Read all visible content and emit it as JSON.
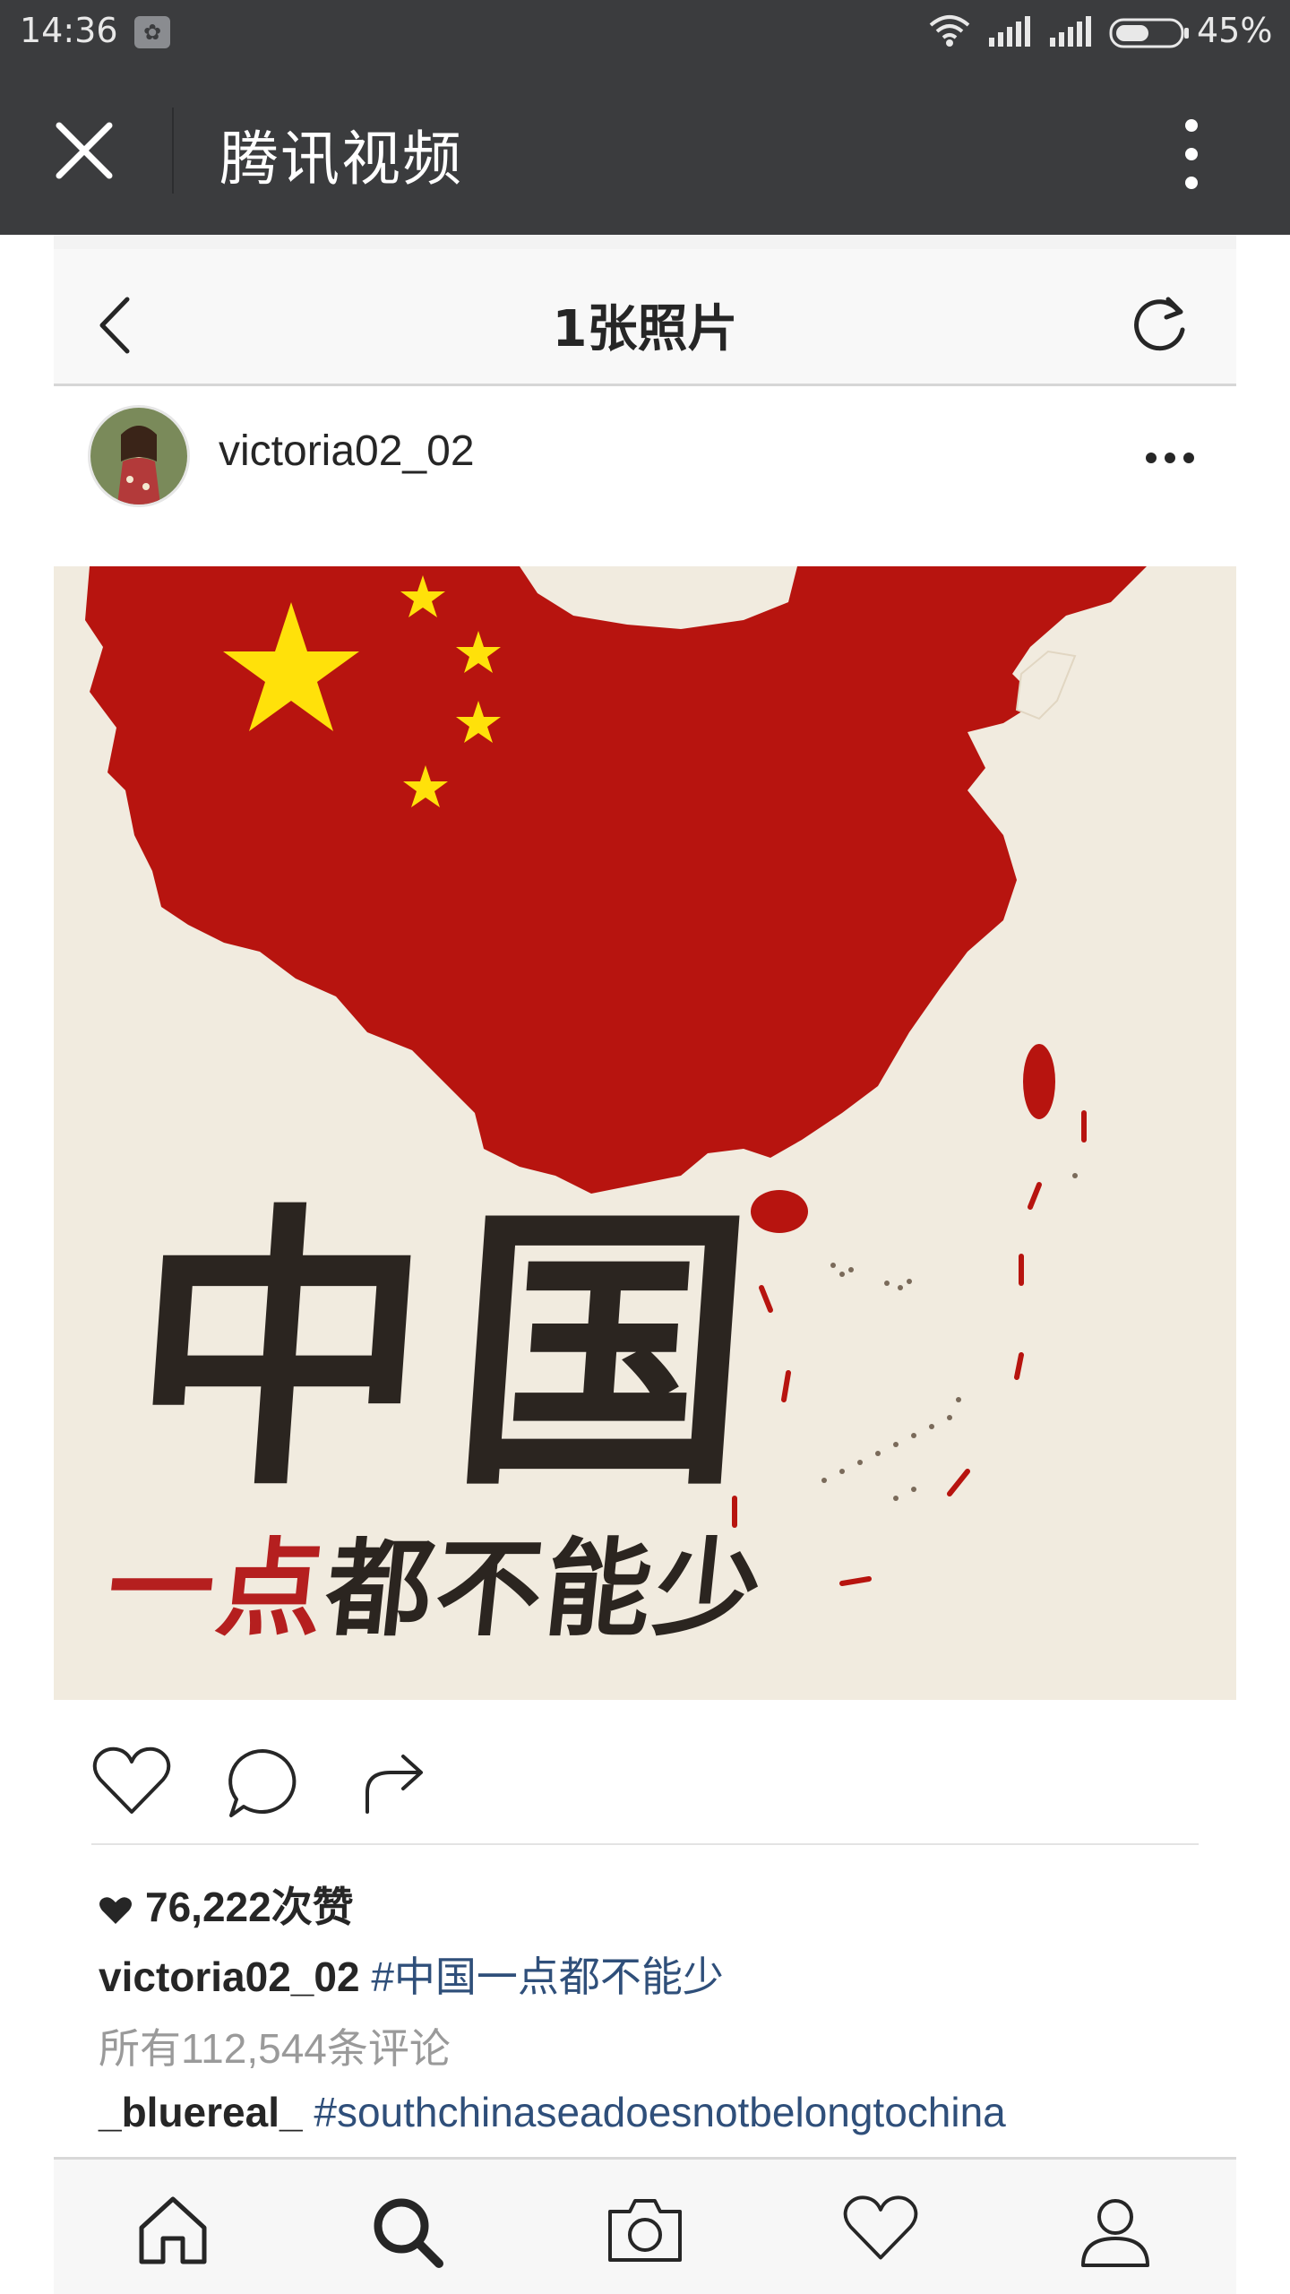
{
  "status_bar": {
    "time": "14:36",
    "battery_percent": "45%",
    "icons": [
      "app-notification-icon",
      "wifi-icon",
      "signal-icon",
      "signal-icon",
      "battery-icon"
    ]
  },
  "header": {
    "title": "腾讯视频",
    "close_icon": "close-icon",
    "more_icon": "more-vertical-icon"
  },
  "instagram": {
    "nav_title": "1张照片",
    "back_icon": "chevron-left-icon",
    "refresh_icon": "refresh-icon",
    "post": {
      "username": "victoria02_02",
      "image_text_main": "中国",
      "image_text_sub_red": "一点",
      "image_text_sub_rest": "都不能少",
      "likes": "76,222次赞",
      "caption_username": "victoria02_02",
      "caption_hashtag": "#中国一点都不能少",
      "comments_link": "所有112,544条评论",
      "comment_username": "_bluereal_",
      "comment_hashtag": "#southchinaseadoesnotbelongtochina"
    },
    "tabs": [
      "home-icon",
      "search-icon",
      "camera-icon",
      "heart-icon",
      "profile-icon"
    ]
  },
  "colors": {
    "chrome": "#3b3c3e",
    "flag_red": "#b7140f",
    "star_yellow": "#ffe10a",
    "parchment": "#f1ebdf",
    "hashtag_blue": "#2f4f7a"
  }
}
